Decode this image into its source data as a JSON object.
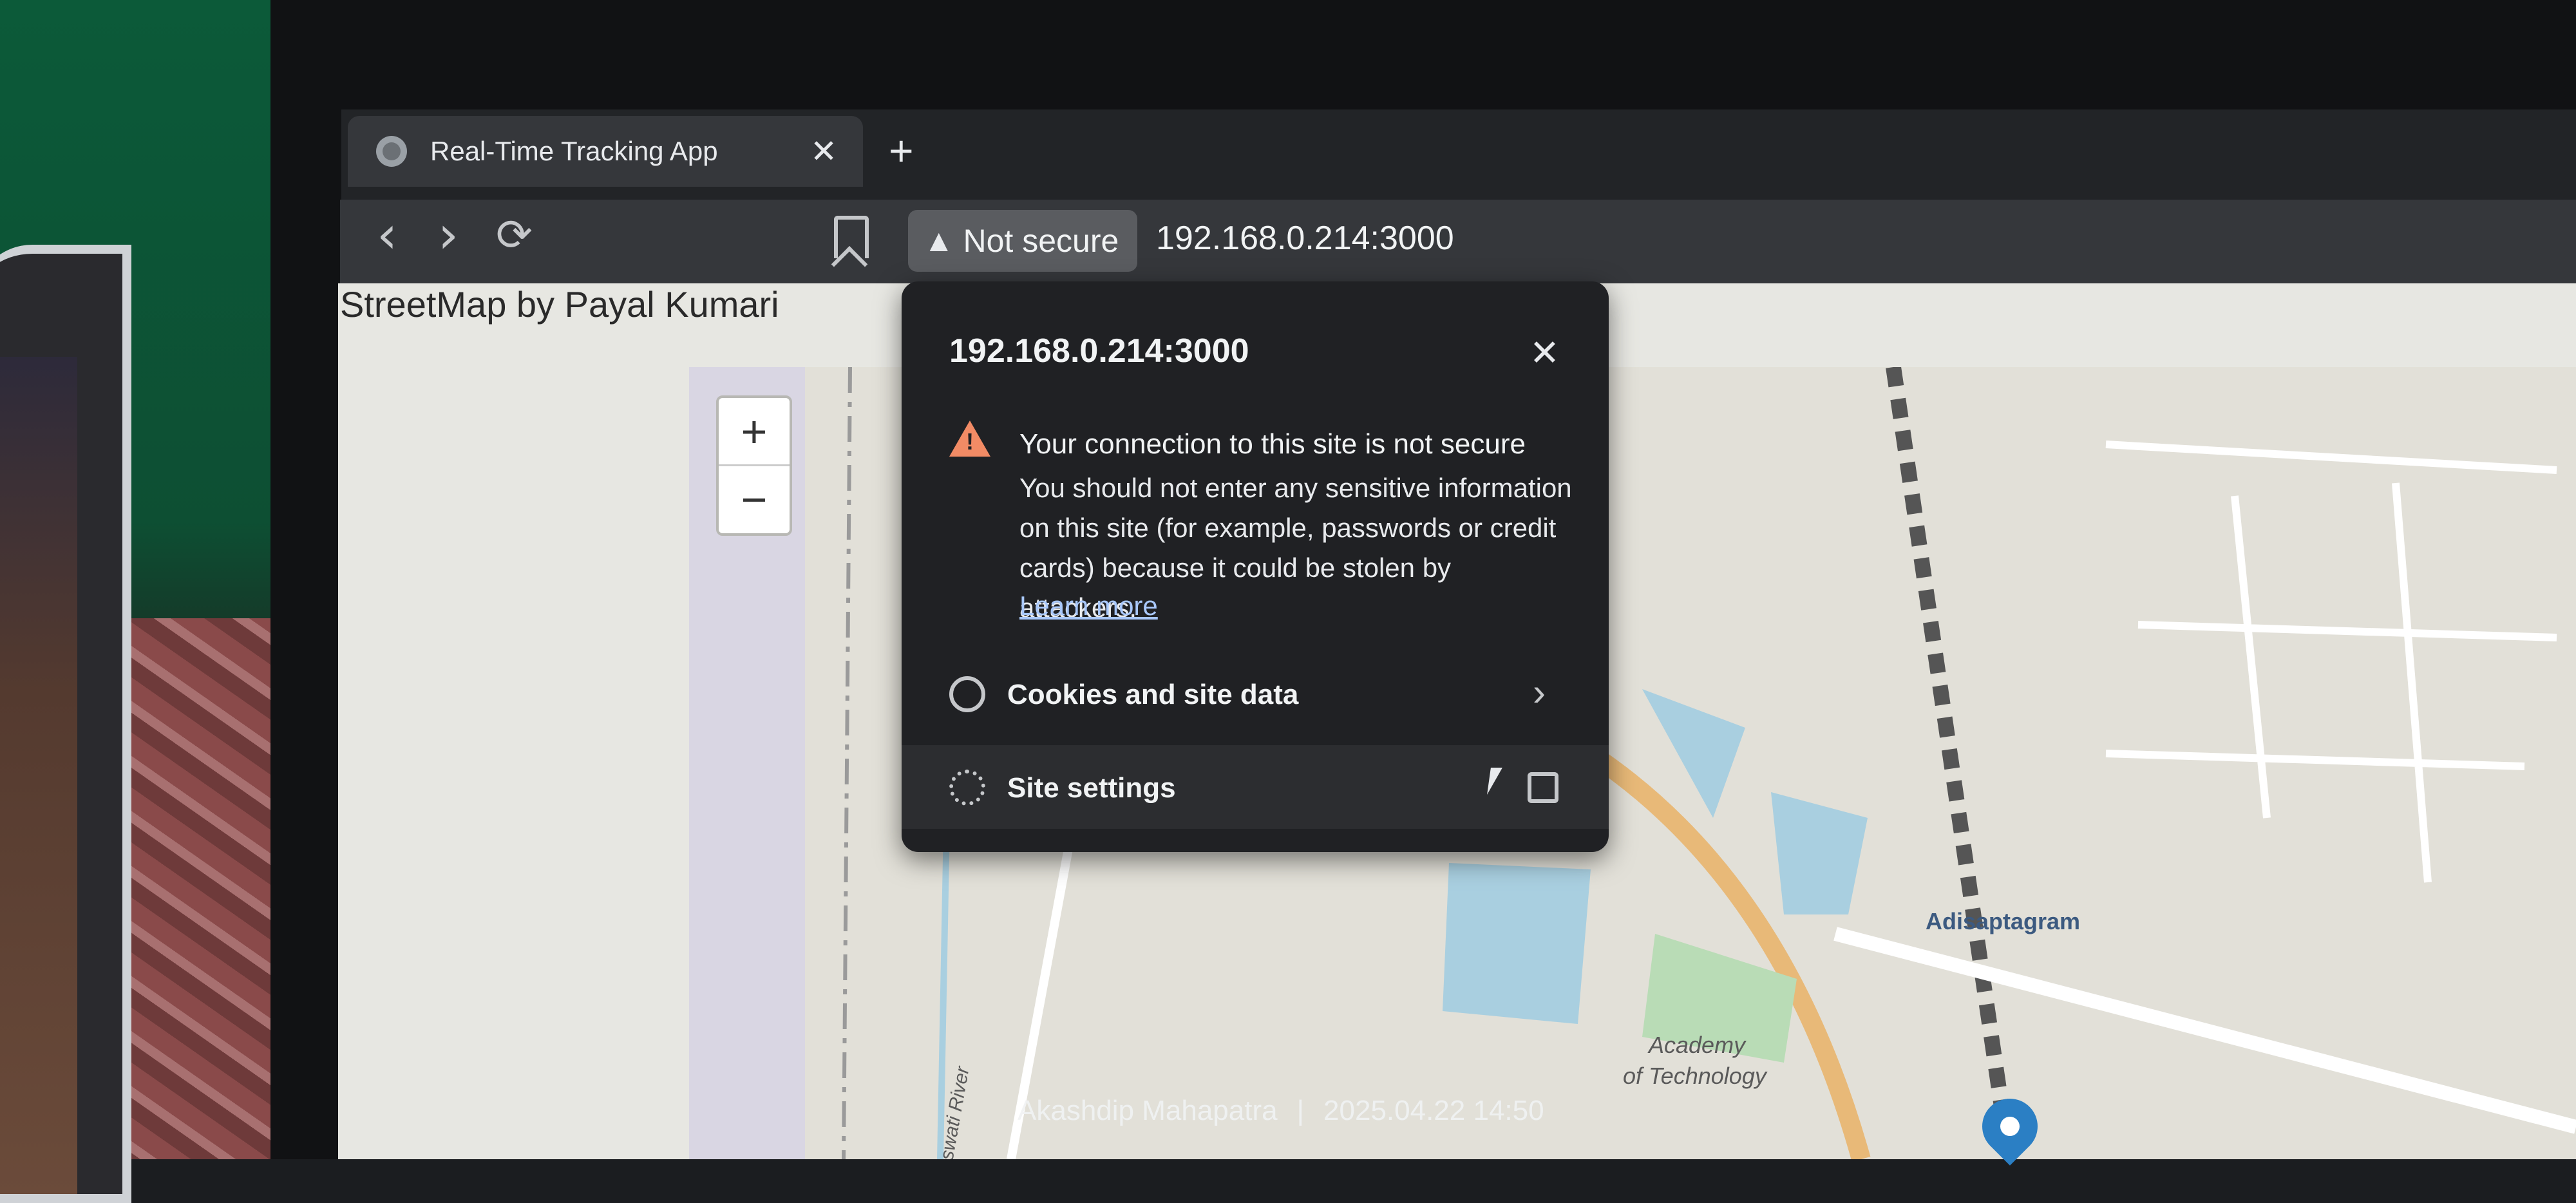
{
  "browser": {
    "tab_title": "Real-Time Tracking App",
    "tab_close": "✕",
    "new_tab": "+",
    "back": "‹",
    "forward": "›",
    "reload": "⟳",
    "security_chip": "Not secure",
    "warn_glyph": "▲",
    "url": "192.168.0.214:3000"
  },
  "page": {
    "header": "StreetMap by Payal Kumari",
    "zoom_in": "+",
    "zoom_out": "−"
  },
  "popup": {
    "host": "192.168.0.214:3000",
    "close": "✕",
    "warning_title": "Your connection to this site is not secure",
    "warning_body": "You should not enter any sensitive information on this site (for example, passwords or credit cards) because it could be stolen by attackers.",
    "learn_more": "Learn more",
    "cookies_label": "Cookies and site data",
    "site_settings_label": "Site settings",
    "chevron": "›"
  },
  "map": {
    "labels": {
      "adisaptagram": "Adisaptagram",
      "academy": "Academy",
      "of_technology": "of Technology",
      "river": "oswati River"
    }
  },
  "watermark": {
    "name": "Akashdip Mahapatra",
    "timestamp": "2025.04.22 14:50"
  },
  "colors": {
    "warning": "#f28b65",
    "link": "#a8c7fa",
    "pin": "#2b7fc4"
  }
}
